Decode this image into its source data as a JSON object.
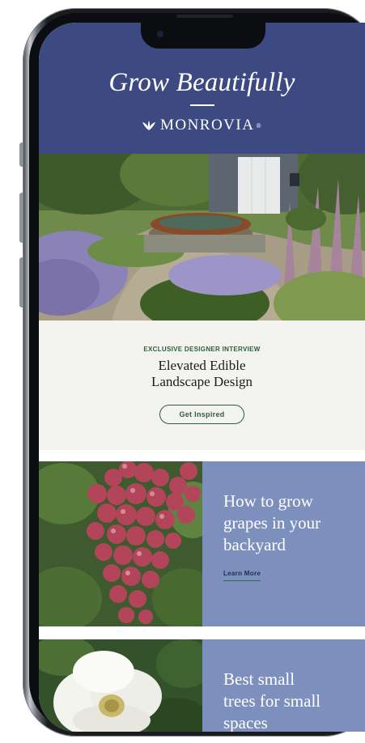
{
  "header": {
    "tagline": "Grow Beautifully",
    "brand": "MONROVIA",
    "brand_mark": "®",
    "background": "#3d4a82"
  },
  "interview": {
    "eyebrow": "EXCLUSIVE DESIGNER INTERVIEW",
    "title_line1": "Elevated Edible",
    "title_line2": "Landscape Design",
    "cta_label": "Get Inspired"
  },
  "articles": [
    {
      "line1": "How to grow",
      "line2": "grapes in your",
      "line3": "backyard",
      "link_label": "Learn More"
    },
    {
      "line1": "Best small",
      "line2": "trees for small",
      "line3": "spaces"
    }
  ],
  "colors": {
    "header_blue": "#3d4a82",
    "card_blue": "#7d90bd",
    "accent_green": "#2f5b3a",
    "card_bg": "#f3f4ef"
  }
}
